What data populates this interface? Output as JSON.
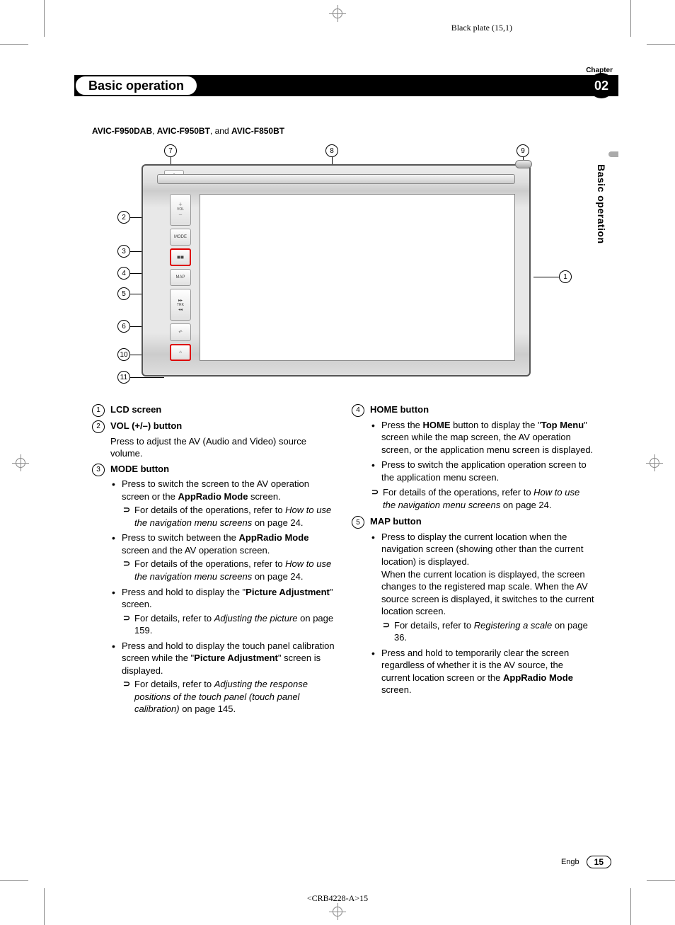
{
  "plate": "Black plate (15,1)",
  "chapter_label": "Chapter",
  "chapter_title": "Basic operation",
  "chapter_number": "02",
  "side_tab_text": "Basic operation",
  "model_line_prefix": "",
  "models": [
    "AVIC-F950DAB",
    "AVIC-F950BT",
    "AVIC-F850BT"
  ],
  "model_joiner_comma": ", ",
  "model_joiner_and": " and ",
  "callouts_top": [
    "7",
    "8",
    "9"
  ],
  "callouts_left": [
    "2",
    "3",
    "4",
    "5",
    "6",
    "10",
    "11"
  ],
  "callout_right": "1",
  "left_col": {
    "i1": {
      "num": "1",
      "title": "LCD screen"
    },
    "i2": {
      "num": "2",
      "title": "VOL (+/–) button",
      "desc": "Press to adjust the AV (Audio and Video) source volume."
    },
    "i3": {
      "num": "3",
      "title": "MODE button",
      "b1_pre": "Press to switch the screen to the AV operation screen or the ",
      "b1_bold": "AppRadio Mode",
      "b1_post": " screen.",
      "b1_ref_pre": "For details of the operations, refer to ",
      "b1_ref_italic": "How to use the navigation menu screens",
      "b1_ref_post": " on page 24.",
      "b2_pre": "Press to switch between the ",
      "b2_bold": "AppRadio Mode",
      "b2_post": " screen and the AV operation screen.",
      "b2_ref_pre": "For details of the operations, refer to ",
      "b2_ref_italic": "How to use the navigation menu screens",
      "b2_ref_post": " on page 24.",
      "b3_pre": "Press and hold to display the \"",
      "b3_bold": "Picture Adjustment",
      "b3_post": "\" screen.",
      "b3_ref_pre": "For details, refer to ",
      "b3_ref_italic": "Adjusting the picture",
      "b3_ref_post": " on page 159.",
      "b4_pre": "Press and hold to display the touch panel calibration screen while the \"",
      "b4_bold": "Picture Adjustment",
      "b4_post": "\" screen is displayed.",
      "b4_ref_pre": "For details, refer to ",
      "b4_ref_italic": "Adjusting the response positions of the touch panel (touch panel calibration)",
      "b4_ref_post": " on page 145."
    }
  },
  "right_col": {
    "i4": {
      "num": "4",
      "title": "HOME button",
      "b1_pre": "Press the ",
      "b1_bold1": "HOME",
      "b1_mid": " button to display the \"",
      "b1_bold2": "Top Menu",
      "b1_post": "\" screen while the map screen, the AV operation screen, or the application menu screen is displayed.",
      "b2": "Press to switch the application operation screen to the application menu screen.",
      "ref_pre": "For details of the operations, refer to ",
      "ref_italic": "How to use the navigation menu screens",
      "ref_post": " on page 24."
    },
    "i5": {
      "num": "5",
      "title": "MAP button",
      "b1": "Press to display the current location when the navigation screen (showing other than the current location) is displayed.",
      "b1b": "When the current location is displayed, the screen changes to the registered map scale. When the AV source screen is displayed, it switches to the current location screen.",
      "b1_ref_pre": "For details, refer to ",
      "b1_ref_italic": "Registering a scale",
      "b1_ref_post": " on page 36.",
      "b2_pre": "Press and hold to temporarily clear the screen regardless of whether it is the AV source, the current location screen or the ",
      "b2_bold": "AppRadio Mode",
      "b2_post": " screen."
    }
  },
  "footer_lang": "Engb",
  "footer_page": "15",
  "footer_code": "<CRB4228-A>15"
}
